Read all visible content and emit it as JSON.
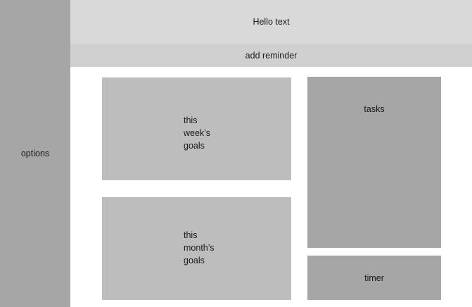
{
  "sidebar": {
    "label": "options"
  },
  "header": {
    "title": "Hello text"
  },
  "reminder": {
    "label": "add reminder"
  },
  "panels": {
    "week_goals": "this\nweek’s\ngoals",
    "month_goals": "this\nmonth’s\ngoals",
    "tasks": "tasks",
    "timer": "timer"
  }
}
